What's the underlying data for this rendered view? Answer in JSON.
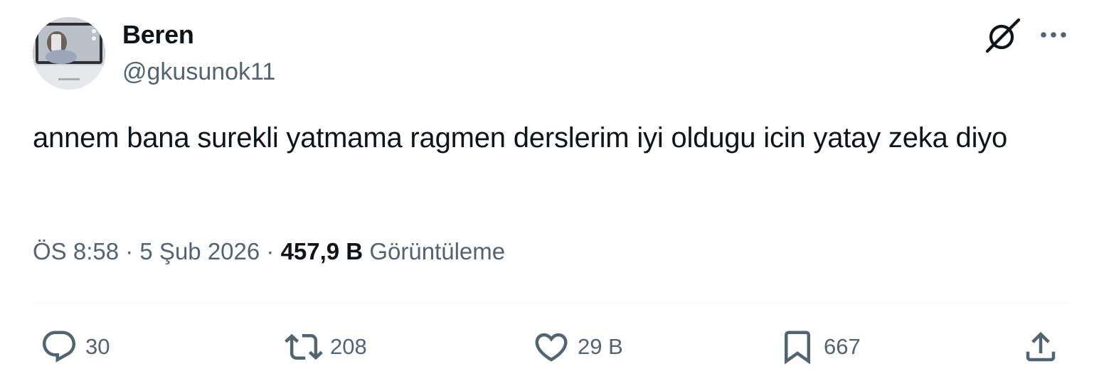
{
  "author": {
    "name": "Beren",
    "handle": "@gkusunok11"
  },
  "tweet": {
    "text": "annem bana surekli yatmama ragmen derslerim iyi oldugu icin yatay zeka diyo"
  },
  "meta": {
    "time": "ÖS 8:58",
    "separator_1": " · ",
    "date": "5 Şub 2026",
    "separator_2": " · ",
    "views_count": "457,9 B",
    "views_label": "Görüntüleme"
  },
  "actions": {
    "reply_count": "30",
    "retweet_count": "208",
    "like_count": "29 B",
    "bookmark_count": "667"
  },
  "icons": {
    "reply": "reply-icon",
    "retweet": "retweet-icon",
    "like": "heart-icon",
    "bookmark": "bookmark-icon",
    "share": "share-icon",
    "grok": "grok-icon",
    "more": "more-icon"
  },
  "colors": {
    "text_primary": "#0f1419",
    "text_secondary": "#536471",
    "divider": "#eff3f4"
  }
}
